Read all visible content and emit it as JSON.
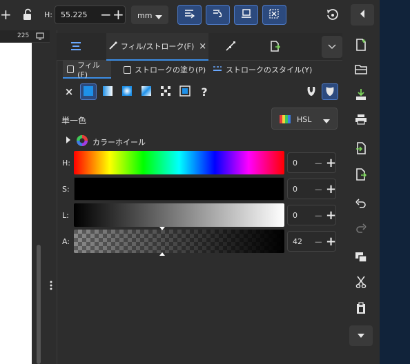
{
  "toolbar": {
    "h_label": "H:",
    "h_value": "55.225",
    "unit": "mm",
    "ruler_mark": "225"
  },
  "dialog_tabs": [
    {
      "label": "フィル/ストローク(F)"
    }
  ],
  "subtabs": {
    "fill": "フィル(F)",
    "stroke_paint": "ストロークの塗り(P)",
    "stroke_style": "ストロークのスタイル(Y)"
  },
  "paint_unknown": "?",
  "color": {
    "mode_title": "単一色",
    "model": "HSL",
    "wheel_label": "カラーホイール",
    "sliders": [
      {
        "label": "H:",
        "value": "0"
      },
      {
        "label": "S:",
        "value": "0"
      },
      {
        "label": "L:",
        "value": "0"
      },
      {
        "label": "A:",
        "value": "42"
      }
    ],
    "alpha_fraction": 0.42
  },
  "accent": "#3c8ee6",
  "icons": {
    "toolbar": [
      "plus-icon",
      "lock-icon",
      "minus-icon",
      "plus-icon",
      "chevron-down-icon",
      "align-icon-1",
      "align-icon-2",
      "align-icon-3",
      "align-icon-4",
      "rotate-icon",
      "collapse-left-icon"
    ],
    "commands": [
      "new-document-icon",
      "open-folder-icon",
      "save-icon",
      "print-icon",
      "import-icon",
      "export-icon",
      "undo-icon",
      "redo-icon",
      "duplicate-icon",
      "cut-icon",
      "paste-icon",
      "more-down-icon"
    ]
  }
}
